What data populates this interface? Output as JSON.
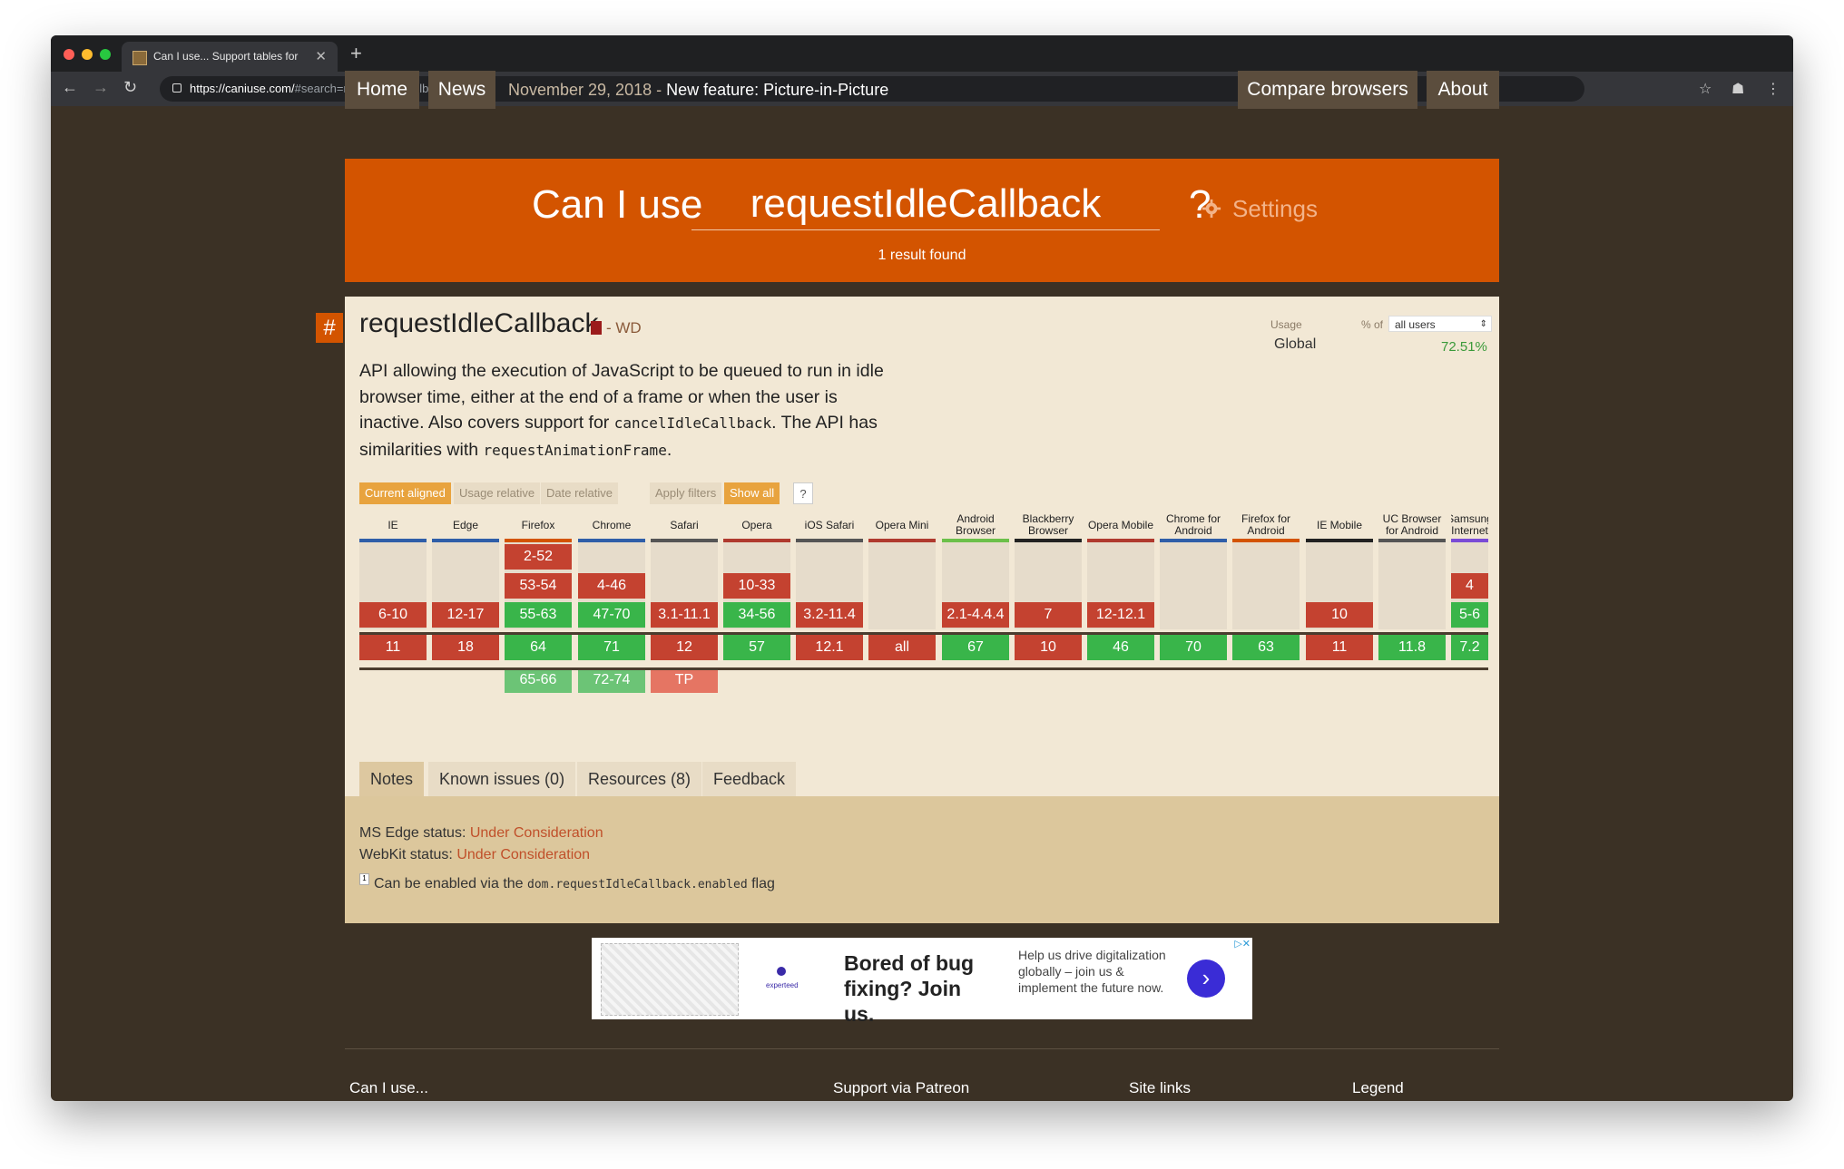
{
  "browser": {
    "tab_title": "Can I use... Support tables for",
    "url_host": "https://caniuse.com/",
    "url_path": "#search=requestIdleCallback"
  },
  "topnav": {
    "home": "Home",
    "news": "News",
    "news_date": "November 29, 2018 -",
    "news_title": "New feature: Picture-in-Picture",
    "compare": "Compare browsers",
    "about": "About"
  },
  "search": {
    "prefix": "Can I use",
    "value": "requestIdleCallback",
    "suffix": "?",
    "settings": "Settings",
    "result": "1 result found"
  },
  "feature": {
    "hash": "#",
    "title": "requestIdleCallback",
    "status": "- WD",
    "desc_1": "API allowing the execution of JavaScript to be queued to run in idle browser time, either at the end of a frame or when the user is inactive. Also covers support for ",
    "desc_code1": "cancelIdleCallback",
    "desc_2": ". The API has similarities with ",
    "desc_code2": "requestAnimationFrame",
    "desc_3": ".",
    "usage_label": "Usage",
    "pct_of": "% of",
    "users_select": "all users",
    "global_label": "Global",
    "global_pct": "72.51%"
  },
  "filters": {
    "current_aligned": "Current aligned",
    "usage_relative": "Usage relative",
    "date_relative": "Date relative",
    "apply_filters": "Apply filters",
    "show_all": "Show all",
    "help": "?"
  },
  "browsers": [
    {
      "name": "IE",
      "bar": "#2f5ea8",
      "r1": "",
      "r2": "",
      "r3": "6-10",
      "r3c": "r",
      "cur": "11",
      "curc": "r",
      "fut": "",
      "futc": ""
    },
    {
      "name": "Edge",
      "bar": "#2f5ea8",
      "r1": "",
      "r2": "",
      "r3": "12-17",
      "r3c": "r",
      "cur": "18",
      "curc": "r",
      "fut": "",
      "futc": ""
    },
    {
      "name": "Firefox",
      "bar": "#d35400",
      "r1": "2-52",
      "r1c": "r",
      "r2": "53-54",
      "r2c": "r",
      "r3": "55-63",
      "r3c": "g",
      "cur": "64",
      "curc": "g",
      "fut": "65-66",
      "futc": "lg"
    },
    {
      "name": "Chrome",
      "bar": "#2f5ea8",
      "r1": "",
      "r2": "4-46",
      "r2c": "r",
      "r3": "47-70",
      "r3c": "g",
      "cur": "71",
      "curc": "g",
      "fut": "72-74",
      "futc": "lg"
    },
    {
      "name": "Safari",
      "bar": "#555555",
      "r1": "",
      "r2": "",
      "r3": "3.1-11.1",
      "r3c": "r",
      "cur": "12",
      "curc": "r",
      "fut": "TP",
      "futc": "lr"
    },
    {
      "name": "Opera",
      "bar": "#b03a2e",
      "r1": "",
      "r2": "10-33",
      "r2c": "r",
      "r3": "34-56",
      "r3c": "g",
      "cur": "57",
      "curc": "g",
      "fut": "",
      "futc": ""
    },
    {
      "name": "iOS Safari",
      "bar": "#555555",
      "r1": "",
      "r2": "",
      "r3": "3.2-11.4",
      "r3c": "r",
      "cur": "12.1",
      "curc": "r",
      "fut": "",
      "futc": ""
    },
    {
      "name": "Opera Mini",
      "bar": "#b03a2e",
      "r1": "",
      "r2": "",
      "r3": "",
      "cur": "all",
      "curc": "r",
      "fut": "",
      "futc": ""
    },
    {
      "name": "Android Browser",
      "bar": "#6cc04a",
      "r1": "",
      "r2": "",
      "r3": "2.1-4.4.4",
      "r3c": "r",
      "cur": "67",
      "curc": "g",
      "fut": "",
      "futc": ""
    },
    {
      "name": "Blackberry Browser",
      "bar": "#222222",
      "r1": "",
      "r2": "",
      "r3": "7",
      "r3c": "r",
      "cur": "10",
      "curc": "r",
      "fut": "",
      "futc": ""
    },
    {
      "name": "Opera Mobile",
      "bar": "#b03a2e",
      "r1": "",
      "r2": "",
      "r3": "12-12.1",
      "r3c": "r",
      "cur": "46",
      "curc": "g",
      "fut": "",
      "futc": ""
    },
    {
      "name": "Chrome for Android",
      "bar": "#2f5ea8",
      "r1": "",
      "r2": "",
      "r3": "",
      "cur": "70",
      "curc": "g",
      "fut": "",
      "futc": ""
    },
    {
      "name": "Firefox for Android",
      "bar": "#d35400",
      "r1": "",
      "r2": "",
      "r3": "",
      "cur": "63",
      "curc": "g",
      "fut": "",
      "futc": ""
    },
    {
      "name": "IE Mobile",
      "bar": "#222222",
      "r1": "",
      "r2": "",
      "r3": "10",
      "r3c": "r",
      "cur": "11",
      "curc": "r",
      "fut": "",
      "futc": ""
    },
    {
      "name": "UC Browser for Android",
      "bar": "#555555",
      "r1": "",
      "r2": "",
      "r3": "",
      "cur": "11.8",
      "curc": "g",
      "fut": "",
      "futc": ""
    },
    {
      "name": "Samsung Internet",
      "bar": "#7a4bd6",
      "r1": "",
      "r2": "4",
      "r2c": "r",
      "r3": "5-6",
      "r3c": "g",
      "cur": "7.2",
      "curc": "g",
      "fut": "",
      "futc": ""
    }
  ],
  "tabs": {
    "notes": "Notes",
    "issues": "Known issues (0)",
    "resources": "Resources (8)",
    "feedback": "Feedback"
  },
  "notes": {
    "edge_label": "MS Edge status:",
    "edge_value": "Under Consideration",
    "webkit_label": "WebKit status:",
    "webkit_value": "Under Consideration",
    "fn_mark": "1",
    "fn_pre": "Can be enabled via the ",
    "fn_code": "dom.requestIdleCallback.enabled",
    "fn_post": " flag"
  },
  "ad": {
    "headline": "Bored of bug fixing? Join us.",
    "sub": "Help us drive digitalization globally – join us & implement the future now.",
    "brand": "experteed",
    "go": "›",
    "x": "▷✕"
  },
  "footer": {
    "canuse": "Can I use...",
    "patreon": "Support via Patreon",
    "sitelinks": "Site links",
    "legend": "Legend"
  }
}
